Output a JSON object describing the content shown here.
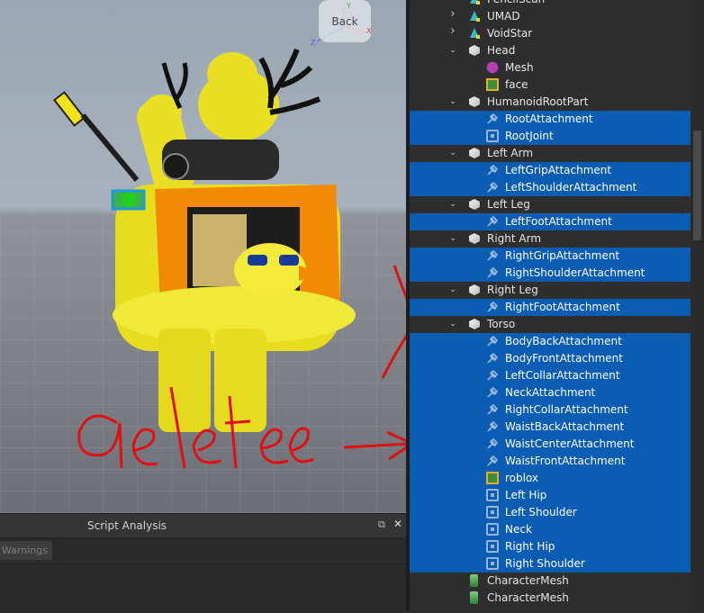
{
  "viewport": {
    "back_label": "Back",
    "axis_labels": [
      "X",
      "Y",
      "Z"
    ],
    "annotation_text": "delete"
  },
  "script_panel": {
    "title": "Script Analysis",
    "pin_icon": "⧉",
    "close_icon": "✕",
    "tab_label": "Warnings"
  },
  "explorer": {
    "rows": [
      {
        "label": "PencilScan",
        "icon": "accessory-icon",
        "indent": 1,
        "arrow": "right",
        "selected": false
      },
      {
        "label": "UMAD",
        "icon": "accessory-icon",
        "indent": 1,
        "arrow": "right",
        "selected": false
      },
      {
        "label": "VoidStar",
        "icon": "accessory-icon",
        "indent": 1,
        "arrow": "right",
        "selected": false
      },
      {
        "label": "Head",
        "icon": "part-icon",
        "indent": 1,
        "arrow": "down",
        "selected": false
      },
      {
        "label": "Mesh",
        "icon": "mesh-icon",
        "indent": 2,
        "arrow": "",
        "selected": false
      },
      {
        "label": "face",
        "icon": "decal-icon",
        "indent": 2,
        "arrow": "",
        "selected": false
      },
      {
        "label": "HumanoidRootPart",
        "icon": "part-icon",
        "indent": 1,
        "arrow": "down",
        "selected": false
      },
      {
        "label": "RootAttachment",
        "icon": "attachment-icon",
        "indent": 2,
        "arrow": "",
        "selected": true
      },
      {
        "label": "RootJoint",
        "icon": "joint-icon",
        "indent": 2,
        "arrow": "",
        "selected": true
      },
      {
        "label": "Left Arm",
        "icon": "part-icon",
        "indent": 1,
        "arrow": "down",
        "selected": false
      },
      {
        "label": "LeftGripAttachment",
        "icon": "attachment-icon",
        "indent": 2,
        "arrow": "",
        "selected": true
      },
      {
        "label": "LeftShoulderAttachment",
        "icon": "attachment-icon",
        "indent": 2,
        "arrow": "",
        "selected": true
      },
      {
        "label": "Left Leg",
        "icon": "part-icon",
        "indent": 1,
        "arrow": "down",
        "selected": false
      },
      {
        "label": "LeftFootAttachment",
        "icon": "attachment-icon",
        "indent": 2,
        "arrow": "",
        "selected": true
      },
      {
        "label": "Right Arm",
        "icon": "part-icon",
        "indent": 1,
        "arrow": "down",
        "selected": false
      },
      {
        "label": "RightGripAttachment",
        "icon": "attachment-icon",
        "indent": 2,
        "arrow": "",
        "selected": true
      },
      {
        "label": "RightShoulderAttachment",
        "icon": "attachment-icon",
        "indent": 2,
        "arrow": "",
        "selected": true
      },
      {
        "label": "Right Leg",
        "icon": "part-icon",
        "indent": 1,
        "arrow": "down",
        "selected": false
      },
      {
        "label": "RightFootAttachment",
        "icon": "attachment-icon",
        "indent": 2,
        "arrow": "",
        "selected": true
      },
      {
        "label": "Torso",
        "icon": "part-icon",
        "indent": 1,
        "arrow": "down",
        "selected": false
      },
      {
        "label": "BodyBackAttachment",
        "icon": "attachment-icon",
        "indent": 2,
        "arrow": "",
        "selected": true
      },
      {
        "label": "BodyFrontAttachment",
        "icon": "attachment-icon",
        "indent": 2,
        "arrow": "",
        "selected": true
      },
      {
        "label": "LeftCollarAttachment",
        "icon": "attachment-icon",
        "indent": 2,
        "arrow": "",
        "selected": true
      },
      {
        "label": "NeckAttachment",
        "icon": "attachment-icon",
        "indent": 2,
        "arrow": "",
        "selected": true
      },
      {
        "label": "RightCollarAttachment",
        "icon": "attachment-icon",
        "indent": 2,
        "arrow": "",
        "selected": true
      },
      {
        "label": "WaistBackAttachment",
        "icon": "attachment-icon",
        "indent": 2,
        "arrow": "",
        "selected": true
      },
      {
        "label": "WaistCenterAttachment",
        "icon": "attachment-icon",
        "indent": 2,
        "arrow": "",
        "selected": true
      },
      {
        "label": "WaistFrontAttachment",
        "icon": "attachment-icon",
        "indent": 2,
        "arrow": "",
        "selected": true
      },
      {
        "label": "roblox",
        "icon": "decal-icon",
        "indent": 2,
        "arrow": "",
        "selected": true
      },
      {
        "label": "Left Hip",
        "icon": "joint-icon",
        "indent": 2,
        "arrow": "",
        "selected": true
      },
      {
        "label": "Left Shoulder",
        "icon": "joint-icon",
        "indent": 2,
        "arrow": "",
        "selected": true
      },
      {
        "label": "Neck",
        "icon": "joint-icon",
        "indent": 2,
        "arrow": "",
        "selected": true
      },
      {
        "label": "Right Hip",
        "icon": "joint-icon",
        "indent": 2,
        "arrow": "",
        "selected": true
      },
      {
        "label": "Right Shoulder",
        "icon": "joint-icon",
        "indent": 2,
        "arrow": "",
        "selected": true
      },
      {
        "label": "CharacterMesh",
        "icon": "character-mesh-icon",
        "indent": 1,
        "arrow": "",
        "selected": false
      },
      {
        "label": "CharacterMesh",
        "icon": "character-mesh-icon",
        "indent": 1,
        "arrow": "",
        "selected": false
      }
    ]
  },
  "colors": {
    "selection": "#0b5cb3",
    "panel_bg": "#2e2e2e",
    "annotation_red": "#e01010"
  }
}
